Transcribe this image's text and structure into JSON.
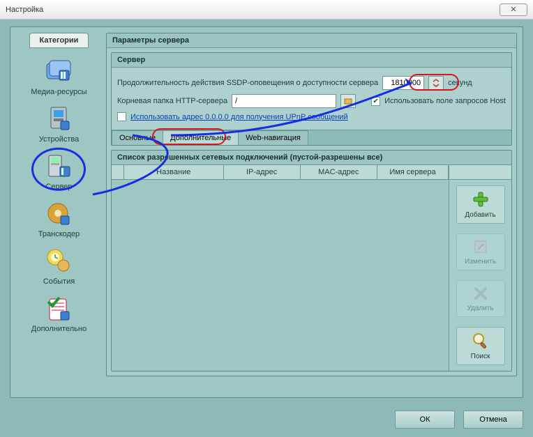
{
  "window": {
    "title": "Настройка",
    "close_glyph": "✕"
  },
  "sidebar": {
    "header": "Категории",
    "items": [
      {
        "label": "Медиа-ресурсы"
      },
      {
        "label": "Устройства"
      },
      {
        "label": "Сервер"
      },
      {
        "label": "Транскодер"
      },
      {
        "label": "События"
      },
      {
        "label": "Дополнительно"
      }
    ]
  },
  "main": {
    "panel_title": "Параметры сервера",
    "server_group": "Сервер",
    "ssdp_label": "Продолжительность действия SSDP-оповещения о доступности сервера",
    "ssdp_value": "1810000",
    "ssdp_unit": "секунд",
    "root_label": "Корневая папка HTTP-сервера",
    "root_value": "/",
    "use_host_label": "Использовать поле запросов Host",
    "use_any_addr_label": "Использовать адрес 0.0.0.0 для получения UPnP сообщений",
    "tabs": [
      "Основные",
      "Дополнительные",
      "Web-навигация"
    ],
    "connections_title": "Список разрешенных сетевых подключений (пустой-разрешены все)",
    "columns": [
      "Название",
      "IP-адрес",
      "MAC-адрес",
      "Имя сервера"
    ],
    "actions": {
      "add": "Добавить",
      "edit": "Изменить",
      "delete": "Удалить",
      "search": "Поиск"
    }
  },
  "buttons": {
    "ok": "ОК",
    "cancel": "Отмена"
  }
}
